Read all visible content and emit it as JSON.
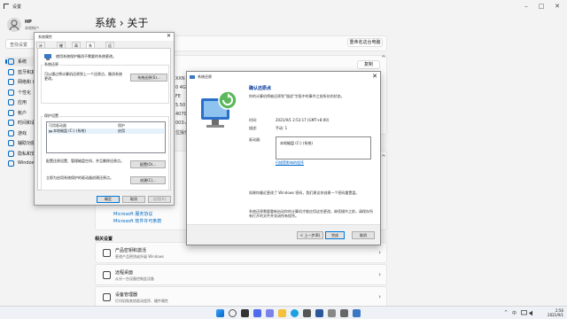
{
  "settings": {
    "window_title": "设置",
    "user": {
      "name": "HP",
      "sub": "本地帐户"
    },
    "breadcrumb": "系统  ›  关于",
    "search_placeholder": "查找设置",
    "nav": [
      {
        "label": "系统",
        "icon": "monitor-icon",
        "active": true
      },
      {
        "label": "蓝牙和其他",
        "icon": "bluetooth-icon"
      },
      {
        "label": "网络和 Int",
        "icon": "network-icon"
      },
      {
        "label": "个性化",
        "icon": "brush-icon"
      },
      {
        "label": "应用",
        "icon": "apps-icon"
      },
      {
        "label": "帐户",
        "icon": "account-icon"
      },
      {
        "label": "时间和语言",
        "icon": "clock-icon"
      },
      {
        "label": "游戏",
        "icon": "gamepad-icon"
      },
      {
        "label": "辅助功能",
        "icon": "accessibility-icon"
      },
      {
        "label": "隐私和安全",
        "icon": "shield-icon"
      },
      {
        "label": "Windows",
        "icon": "update-icon"
      }
    ],
    "rename_button": "重命名这台电脑",
    "copy_button": "复制",
    "truncated_values": [
      "XXN",
      "0 4G",
      "FE",
      "5.50",
      "4070",
      "003-A",
      "位操作"
    ],
    "links": [
      "Microsoft 服务协议",
      "Microsoft 软件许可条款"
    ],
    "related_heading": "相关设置",
    "related": [
      {
        "title": "产品密钥和激活",
        "sub": "更改产品密钥或升级 Windows",
        "icon": "key-icon"
      },
      {
        "title": "远程桌面",
        "sub": "从另一台设备控制此设备",
        "icon": "remote-icon"
      },
      {
        "title": "设备管理器",
        "sub": "打印机和其他驱动程序、硬件属性",
        "icon": "device-manager-icon"
      }
    ]
  },
  "sysprop": {
    "title": "系统属性",
    "close": "✕",
    "tabs": [
      "计算机名",
      "硬件",
      "高级",
      "系统保护",
      "远程"
    ],
    "active_tab": 3,
    "intro": "使用系统保护撤消不需要的系统更改。",
    "restore_heading": "系统还原",
    "restore_text": "可以通过将计算机还原到上一个还原点，撤消系统更改。",
    "restore_button": "系统还原(S)...",
    "protect_heading": "保护设置",
    "col_drive": "可用驱动器",
    "col_protect": "保护",
    "drive_name": "本地磁盘 (C:) (系统)",
    "drive_state": "启用",
    "config_text": "配置还原设置、管理磁盘空间，并且删除还原点。",
    "config_button": "配置(O)...",
    "create_text": "立即为启用系统保护的驱动器创建还原点。",
    "create_button": "创建(C)...",
    "ok": "确定",
    "cancel": "取消",
    "apply": "应用(A)"
  },
  "wizard": {
    "title": "系统还原",
    "close": "✕",
    "heading": "确认还原点",
    "sub": "你的计算机将被还原到\"描述\"字段中的事件之前所处的状态。",
    "time_label": "时间:",
    "time_value": "2021/9/1 2:53:17 (GMT+8:00)",
    "desc_label": "描述:",
    "desc_value": "手动: 1",
    "drives_label": "驱动器:",
    "drives_value": "本地磁盘 (C:) (系统)",
    "scan_link": "扫描受影响的程序",
    "note1": "如果你最近更改了 Windows 密码，我们建议你创建一个密码重置盘。",
    "note2": "系统还原需要重新启动你的计算机才能应用这些更改。继续操作之前，请保存所有打开的文件并关闭所有程序。",
    "back": "< 上一步(B)",
    "finish": "完成",
    "cancel": "取消"
  },
  "taskbar": {
    "time": "2:56",
    "date": "2021/9/1",
    "tray_lang": "中",
    "tray_chevron": "^"
  },
  "colors": {
    "accent": "#0067c0",
    "highlight": "#e81123"
  }
}
